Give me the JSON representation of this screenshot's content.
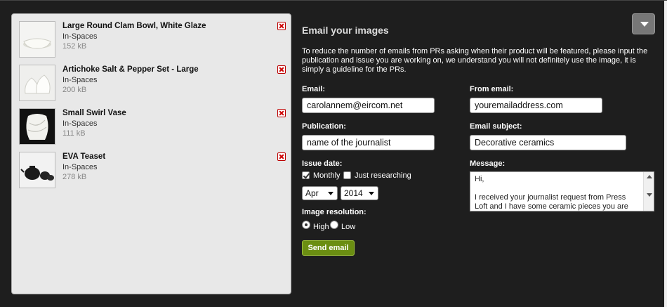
{
  "images": [
    {
      "title": "Large Round Clam Bowl, White Glaze",
      "brand": "In-Spaces",
      "size": "152 kB",
      "icon": "bowl"
    },
    {
      "title": "Artichoke Salt & Pepper Set - Large",
      "brand": "In-Spaces",
      "size": "200 kB",
      "icon": "artichoke"
    },
    {
      "title": "Small Swirl Vase",
      "brand": "In-Spaces",
      "size": "111 kB",
      "icon": "vase"
    },
    {
      "title": "EVA Teaset",
      "brand": "In-Spaces",
      "size": "278 kB",
      "icon": "teaset"
    }
  ],
  "form": {
    "title": "Email your images",
    "intro": "To reduce the number of emails from PRs asking when their product will be featured, please input the publication and issue you are working on, we understand you will not definitely use the image, it is simply a guideline for the PRs.",
    "email_label": "Email:",
    "email_value": "carolannem@eircom.net",
    "from_email_label": "From email:",
    "from_email_value": "youremailaddress.com",
    "publication_label": "Publication:",
    "publication_value": "name of the journalist",
    "subject_label": "Email subject:",
    "subject_value": "Decorative ceramics",
    "issue_label": "Issue date:",
    "monthly_label": "Monthly",
    "researching_label": "Just researching",
    "month_value": "Apr",
    "year_value": "2014",
    "message_label": "Message:",
    "message_line1": "Hi,",
    "message_line2": "I received your journalist request from Press Loft and I have some ceramic pieces you are",
    "resolution_label": "Image resolution:",
    "high_label": "High",
    "low_label": "Low",
    "send_label": "Send email"
  },
  "colors": {
    "send_button": "#6b8e12",
    "background": "#1e1e1e",
    "list_panel": "#e8e8e8"
  }
}
